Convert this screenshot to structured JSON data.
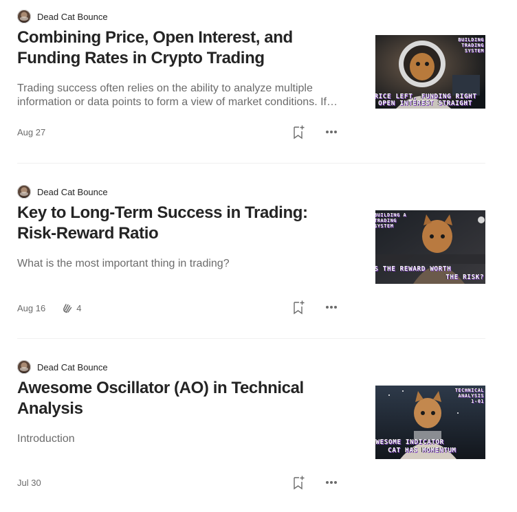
{
  "colors": {
    "text": "#242424",
    "muted": "#6b6b6b",
    "divider": "#f0f0f0"
  },
  "articles": [
    {
      "author": "Dead Cat Bounce",
      "title": "Combining Price, Open Interest, and Funding Rates in Crypto Trading",
      "subtitle": "Trading success often relies on the ability to analyze multiple information or data points to form a view of market conditions. If…",
      "date": "Aug 27",
      "claps": "",
      "thumbnail": {
        "top_text": [
          "BUILDING",
          "TRADING",
          "SYSTEM"
        ],
        "bottom_text": [
          "PRICE LEFT, FUNDING RIGHT",
          "OPEN INTEREST STRAIGHT"
        ]
      }
    },
    {
      "author": "Dead Cat Bounce",
      "title": "Key to Long-Term Success in Trading: Risk-Reward Ratio",
      "subtitle": "What is the most important thing in trading?",
      "date": "Aug 16",
      "claps": "4",
      "thumbnail": {
        "top_text": [
          "BUILDING A",
          "TRADING",
          "SYSTEM"
        ],
        "bottom_text": [
          "IS THE REWARD WORTH",
          "THE RISK?"
        ]
      }
    },
    {
      "author": "Dead Cat Bounce",
      "title": "Awesome Oscillator (AO) in Technical Analysis",
      "subtitle": "Introduction",
      "date": "Jul 30",
      "claps": "",
      "thumbnail": {
        "top_text": [
          "TECHNICAL",
          "ANALYSIS",
          "1-01"
        ],
        "bottom_text": [
          "AWESOME INDICATOR",
          "CAT HAS MOMENTUM"
        ]
      }
    }
  ]
}
